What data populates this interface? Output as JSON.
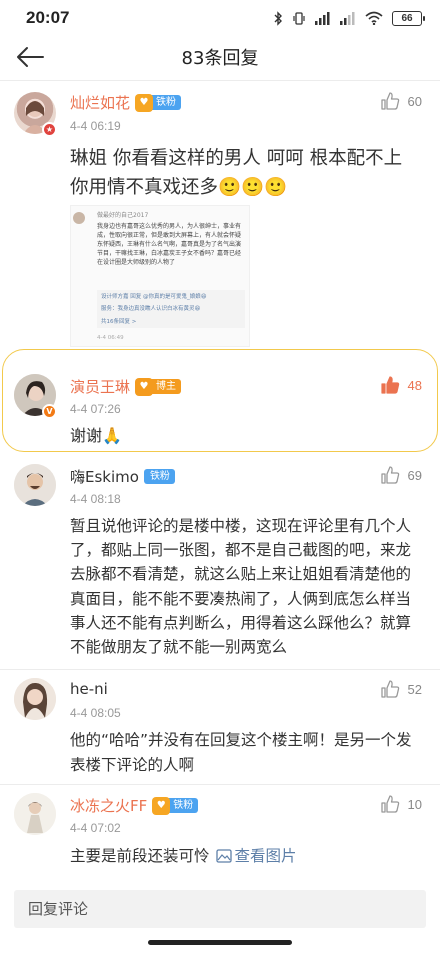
{
  "status_bar": {
    "time": "20:07",
    "battery": "66",
    "icons": [
      "bluetooth-icon",
      "vibrate-icon",
      "signal-icon",
      "signal-icon",
      "wifi-icon",
      "battery-icon"
    ]
  },
  "nav": {
    "title": "83条回复",
    "back_icon": "back-arrow-icon"
  },
  "comments": [
    {
      "name": "灿烂如花",
      "fan_badge": "铁粉",
      "time": "4-4 06:19",
      "likes": "60",
      "text": "琳姐 你看看这样的男人 呵呵 根本配不上你用情不真戏还多🙂🙂🙂",
      "embedded": {
        "author": "做最好的自己2017",
        "body": "我身边也有嘉哥这么优秀的男人，为人很绅士，事业有成，性取向很正常，但是敢到大屏幕上，有人就会怀疑东怀疑西，王琳有什么名气啊，嘉哥真是为了名气出演节目，干嘛找王琳，白冰嘉炭王子女不香吗？嘉哥已经在设计圈是大师级别的人物了",
        "reply1": "设计师方嘉 回复 @你真的是可爱鬼_娘娘😄",
        "reply2": "服务：我身边真没瞧人认识白冰有黄灵😄",
        "reply_count": "共16条回复 >",
        "time": "4-4 06:49"
      }
    },
    {
      "name": "演员王琳",
      "role_badge": "博主",
      "time": "4-4 07:26",
      "likes": "48",
      "text": "谢谢🙏"
    },
    {
      "name": "嗨Eskimo",
      "fan_badge": "铁粉",
      "time": "4-4 08:18",
      "likes": "69",
      "text": "暂且说他评论的是楼中楼，这现在评论里有几个人了，都贴上同一张图，都不是自己截图的吧，来龙去脉都不看清楚，就这么贴上来让姐姐看清楚他的真面目，能不能不要凑热闹了，人俩到底怎么样当事人还不能有点判断么，用得着这么踩他么？就算不能做朋友了就不能一别两宽么"
    },
    {
      "name": "he-ni",
      "time": "4-4 08:05",
      "likes": "52",
      "text": "他的“哈哈”并没有在回复这个楼主啊！是另一个发表楼下评论的人啊"
    },
    {
      "name": "冰冻之火FF",
      "fan_badge": "铁粉",
      "time": "4-4 07:02",
      "likes": "10",
      "text": "主要是前段还装可怜",
      "view_image": "查看图片"
    }
  ],
  "reply_bar": {
    "placeholder": "回复评论"
  },
  "colors": {
    "accent": "#eb7350",
    "fan_badge": "#4ca3f0",
    "blogger_badge": "#f49b1e",
    "highlight_outline": "#f2c94c",
    "link": "#5d7fa8"
  }
}
